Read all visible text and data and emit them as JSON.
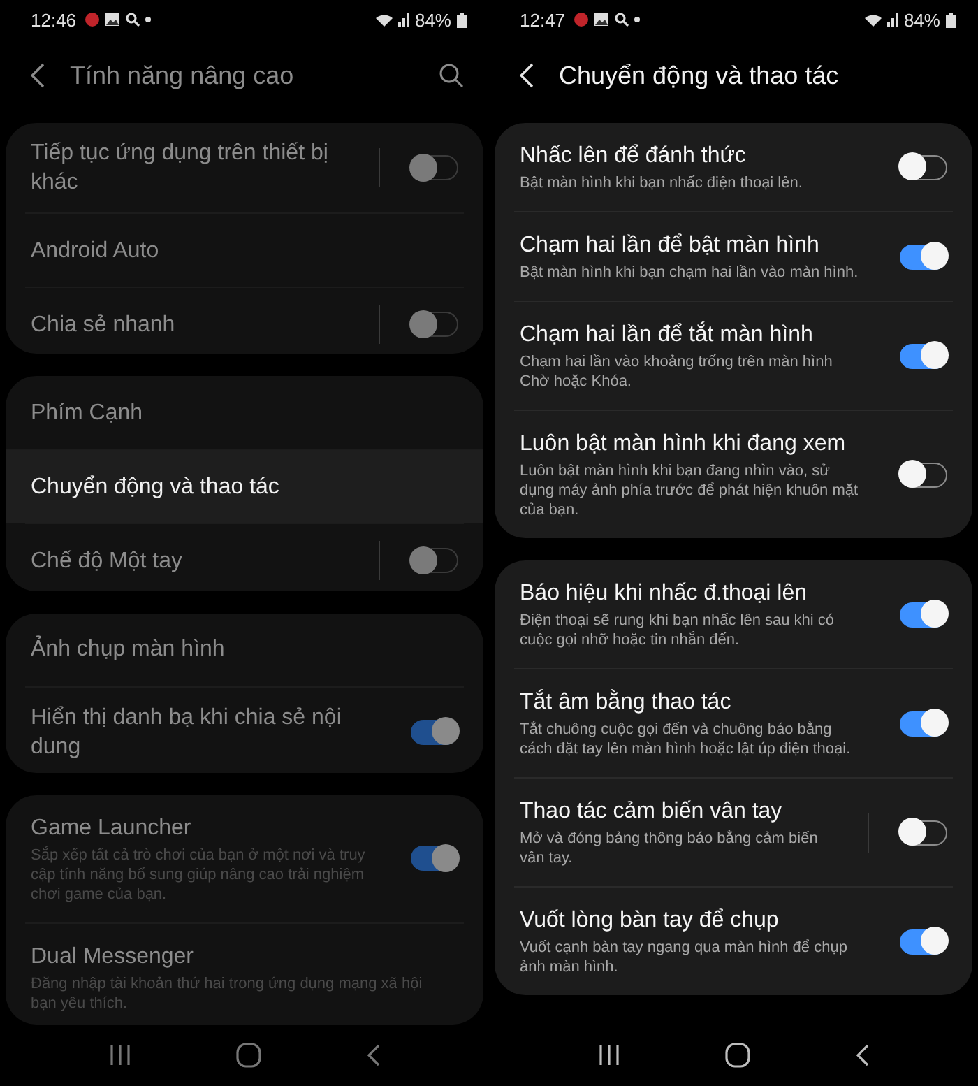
{
  "screens": [
    {
      "dimmed": true,
      "status_bar": {
        "time": "12:46",
        "battery": "84%"
      },
      "header": {
        "title": "Tính năng nâng cao",
        "search": true
      },
      "groups": [
        {
          "items": [
            {
              "kind": "split-switch",
              "title": "Tiếp tục ứng dụng trên thiết bị khác",
              "on": false,
              "selected": false
            },
            {
              "kind": "link",
              "title": "Android Auto",
              "selected": false
            },
            {
              "kind": "split-switch",
              "title": "Chia sẻ nhanh",
              "on": false,
              "selected": false
            }
          ]
        },
        {
          "items": [
            {
              "kind": "link",
              "title": "Phím Cạnh",
              "selected": false
            },
            {
              "kind": "link",
              "title": "Chuyển động và thao tác",
              "selected": true
            },
            {
              "kind": "split-switch",
              "title": "Chế độ Một tay",
              "on": false,
              "selected": false
            }
          ]
        },
        {
          "items": [
            {
              "kind": "link",
              "title": "Ảnh chụp màn hình",
              "selected": false
            },
            {
              "kind": "switch",
              "title": "Hiển thị danh bạ khi chia sẻ nội dung",
              "on": true,
              "selected": false
            }
          ]
        },
        {
          "items": [
            {
              "kind": "switch",
              "title": "Game Launcher",
              "subtitle": "Sắp xếp tất cả trò chơi của bạn ở một nơi và truy cập tính năng bổ sung giúp nâng cao trải nghiệm chơi game của bạn.",
              "on": true,
              "selected": false
            },
            {
              "kind": "link",
              "title": "Dual Messenger",
              "subtitle": "Đăng nhập tài khoản thứ hai trong ứng dụng mạng xã hội bạn yêu thích.",
              "selected": false
            }
          ]
        }
      ]
    },
    {
      "dimmed": false,
      "status_bar": {
        "time": "12:47",
        "battery": "84%"
      },
      "header": {
        "title": "Chuyển động và thao tác",
        "search": false
      },
      "groups": [
        {
          "items": [
            {
              "kind": "switch",
              "title": "Nhấc lên để đánh thức",
              "subtitle": "Bật màn hình khi bạn nhấc điện thoại lên.",
              "on": false,
              "selected": false
            },
            {
              "kind": "switch",
              "title": "Chạm hai lần để bật màn hình",
              "subtitle": "Bật màn hình khi bạn chạm hai lần vào màn hình.",
              "on": true,
              "selected": false
            },
            {
              "kind": "switch",
              "title": "Chạm hai lần để tắt màn hình",
              "subtitle": "Chạm hai lần vào khoảng trống trên màn hình Chờ hoặc Khóa.",
              "on": true,
              "selected": false
            },
            {
              "kind": "switch",
              "title": "Luôn bật màn hình khi đang xem",
              "subtitle": "Luôn bật màn hình khi bạn đang nhìn vào, sử dụng máy ảnh phía trước để phát hiện khuôn mặt của bạn.",
              "on": false,
              "selected": false
            }
          ]
        },
        {
          "items": [
            {
              "kind": "switch",
              "title": "Báo hiệu khi nhấc đ.thoại lên",
              "subtitle": "Điện thoại sẽ rung khi bạn nhấc lên sau khi có cuộc gọi nhỡ hoặc tin nhắn đến.",
              "on": true,
              "selected": false
            },
            {
              "kind": "switch",
              "title": "Tắt âm bằng thao tác",
              "subtitle": "Tắt chuông cuộc gọi đến và chuông báo bằng cách đặt tay lên màn hình hoặc lật úp điện thoại.",
              "on": true,
              "selected": false
            },
            {
              "kind": "split-switch",
              "title": "Thao tác cảm biến vân tay",
              "subtitle": "Mở và đóng bảng thông báo bằng cảm biến vân tay.",
              "on": false,
              "selected": false
            },
            {
              "kind": "switch",
              "title": "Vuốt lòng bàn tay để chụp",
              "subtitle": "Vuốt cạnh bàn tay ngang qua màn hình để chụp ảnh màn hình.",
              "on": true,
              "selected": false
            }
          ]
        }
      ]
    }
  ]
}
